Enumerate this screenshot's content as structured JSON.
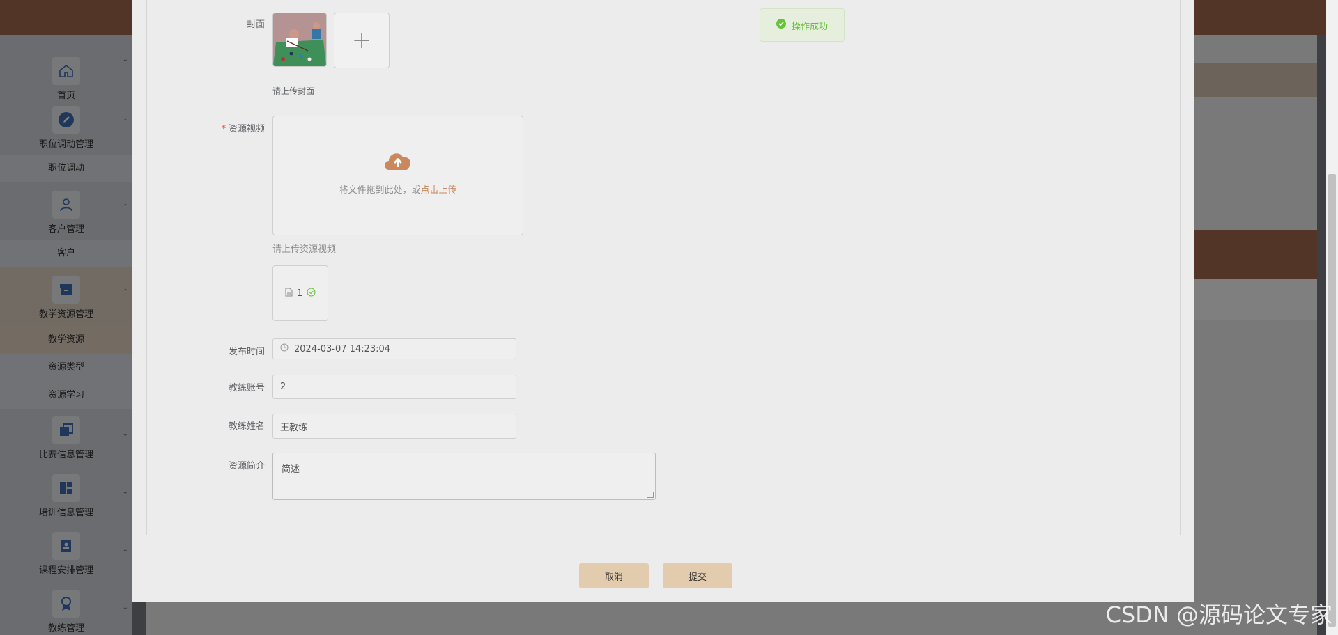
{
  "sidebar": {
    "groups": [
      {
        "label": "首页",
        "icon": "home-icon",
        "subitems": []
      },
      {
        "label": "职位调动管理",
        "icon": "edit-icon",
        "subitems": [
          "职位调动"
        ]
      },
      {
        "label": "客户管理",
        "icon": "user-icon",
        "subitems": [
          "客户"
        ]
      },
      {
        "label": "教学资源管理",
        "icon": "archive-icon",
        "subitems": [
          "教学资源",
          "资源类型",
          "资源学习"
        ]
      },
      {
        "label": "比赛信息管理",
        "icon": "copy-icon",
        "subitems": []
      },
      {
        "label": "培训信息管理",
        "icon": "layout-icon",
        "subitems": []
      },
      {
        "label": "课程安排管理",
        "icon": "badge-icon",
        "subitems": []
      },
      {
        "label": "教练管理",
        "icon": "medal-icon",
        "subitems": []
      }
    ]
  },
  "form": {
    "cover_label": "封面",
    "cover_hint": "请上传封面",
    "video_label": "资源视频",
    "dropzone_text": "将文件拖到此处，或",
    "dropzone_link": "点击上传",
    "video_hint": "请上传资源视频",
    "file_name": "1",
    "publish_time_label": "发布时间",
    "publish_time_value": "2024-03-07 14:23:04",
    "coach_account_label": "教练账号",
    "coach_account_value": "2",
    "coach_name_label": "教练姓名",
    "coach_name_value": "王教练",
    "intro_label": "资源简介",
    "intro_value": "简述"
  },
  "buttons": {
    "cancel": "取消",
    "submit": "提交"
  },
  "toast": {
    "message": "操作成功"
  },
  "watermark": "CSDN @源码论文专家",
  "colors": {
    "accent": "#a46b4e",
    "button": "#e3ccad",
    "success": "#67c23a",
    "link": "#c9885e"
  }
}
